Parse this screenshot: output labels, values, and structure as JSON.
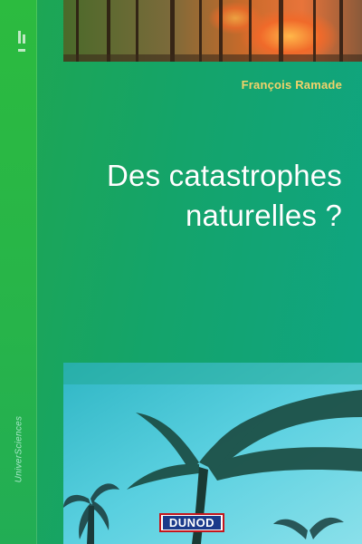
{
  "book": {
    "author": "François Ramade",
    "title_line1": "Des catastrophes",
    "title_line2": "naturelles ?",
    "series": "UniverSciences",
    "publisher": "DUNOD"
  },
  "colors": {
    "background": "#15a46a",
    "spine": "#27b44a",
    "author_text": "#f3d26a",
    "title_text": "#ffffff",
    "publisher_blue": "#1a3a8a",
    "publisher_red": "#c4161c"
  },
  "images": {
    "top": "forest-fire-photo",
    "bottom": "palm-trees-storm-photo"
  }
}
